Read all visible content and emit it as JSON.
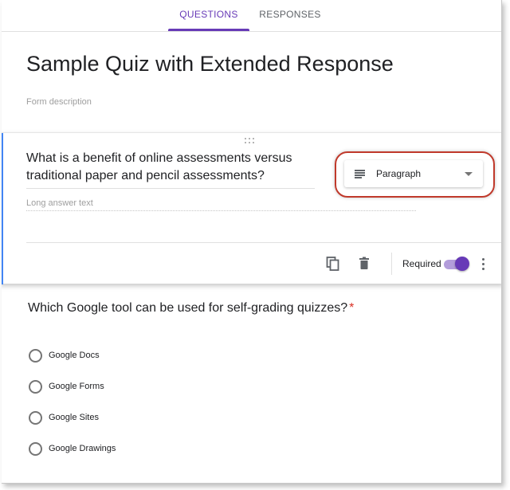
{
  "tabs": [
    {
      "label": "QUESTIONS",
      "active": true
    },
    {
      "label": "RESPONSES",
      "active": false
    }
  ],
  "form": {
    "title": "Sample Quiz with Extended Response",
    "description_placeholder": "Form description"
  },
  "active_question": {
    "text": "What is a benefit of online assessments versus traditional paper and pencil assessments?",
    "answer_placeholder": "Long answer text",
    "type_selector": {
      "icon": "paragraph-lines-icon",
      "label": "Paragraph"
    },
    "footer": {
      "required_label": "Required",
      "required_on": true
    }
  },
  "question2": {
    "text": "Which Google tool can be used for self-grading quizzes?",
    "required_marker": "*",
    "options": [
      "Google Docs",
      "Google Forms",
      "Google Sites",
      "Google Drawings"
    ]
  },
  "colors": {
    "accent": "#673ab7",
    "card_left_border": "#4285f4",
    "highlight_ring": "#c0392b",
    "required_star": "#d93025"
  }
}
